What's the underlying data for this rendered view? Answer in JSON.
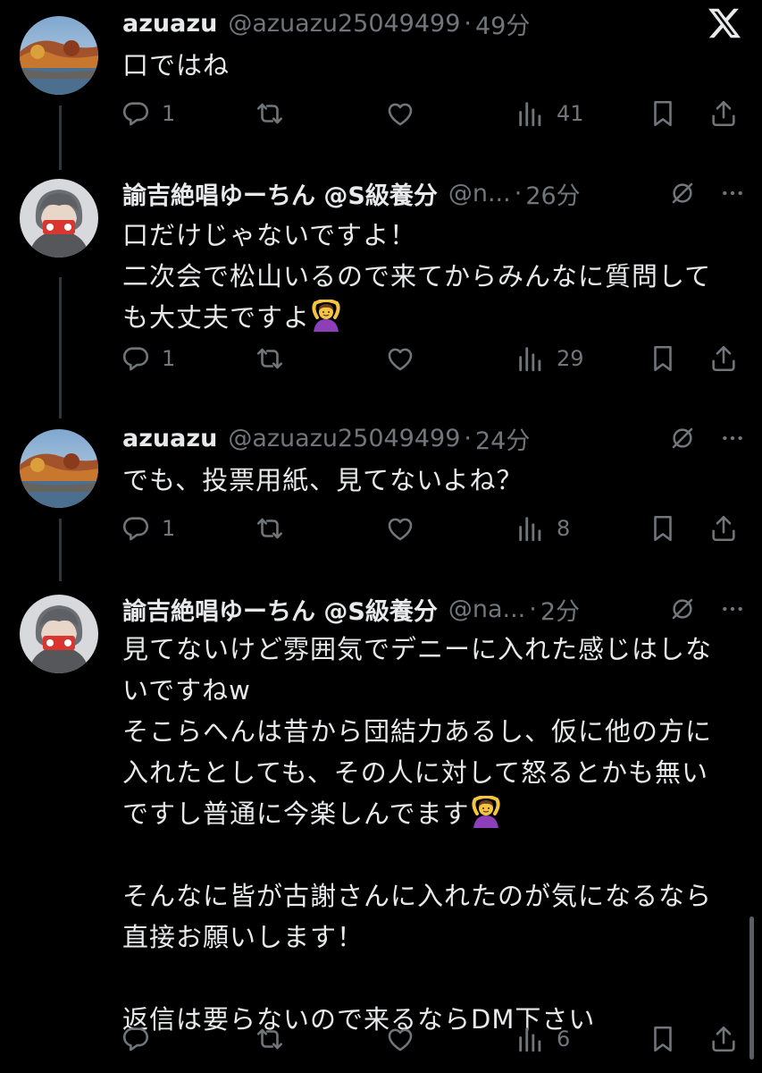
{
  "app": {
    "logo_icon": "x-logo-icon"
  },
  "tweets": [
    {
      "name": "azuazu",
      "handle": "@azuazu25049499",
      "separator": "·",
      "time": "49分",
      "text": "口ではね",
      "emoji": "",
      "replies": "1",
      "views": "41",
      "show_header_icons": false
    },
    {
      "name": "諭吉絶唱ゆーちん @S級養分",
      "handle": "@n...",
      "separator": "·",
      "time": "26分",
      "text": "口だけじゃないですよ！\n二次会で松山いるので来てからみんなに質問して\nも大丈夫ですよ",
      "emoji": "person-gesturing-ok-emoji",
      "replies": "1",
      "views": "29",
      "show_header_icons": true
    },
    {
      "name": "azuazu",
      "handle": "@azuazu25049499",
      "separator": "·",
      "time": "24分",
      "text": "でも、投票用紙、見てないよね？",
      "emoji": "",
      "replies": "1",
      "views": "8",
      "show_header_icons": true
    },
    {
      "name": "諭吉絶唱ゆーちん @S級養分",
      "handle": "@na...",
      "separator": "·",
      "time": "2分",
      "text_part1": "見てないけど雰囲気でデニーに入れた感じはしな\nいですねw\nそこらへんは昔から団結力あるし、仮に他の方に\n入れたとしても、その人に対して怒るとかも無い\nですし普通に今楽しんでます",
      "text_part2": "\n\nそんなに皆が古謝さんに入れたのが気になるなら\n直接お願いします！\n\n返信は要らないので来るならDM下さい",
      "emoji": "person-gesturing-ok-emoji",
      "replies": "",
      "views": "6",
      "show_header_icons": true
    }
  ],
  "colors": {
    "background": "#000000",
    "text": "#e7e9ea",
    "secondary": "#71767b",
    "thread_line": "#333639"
  }
}
